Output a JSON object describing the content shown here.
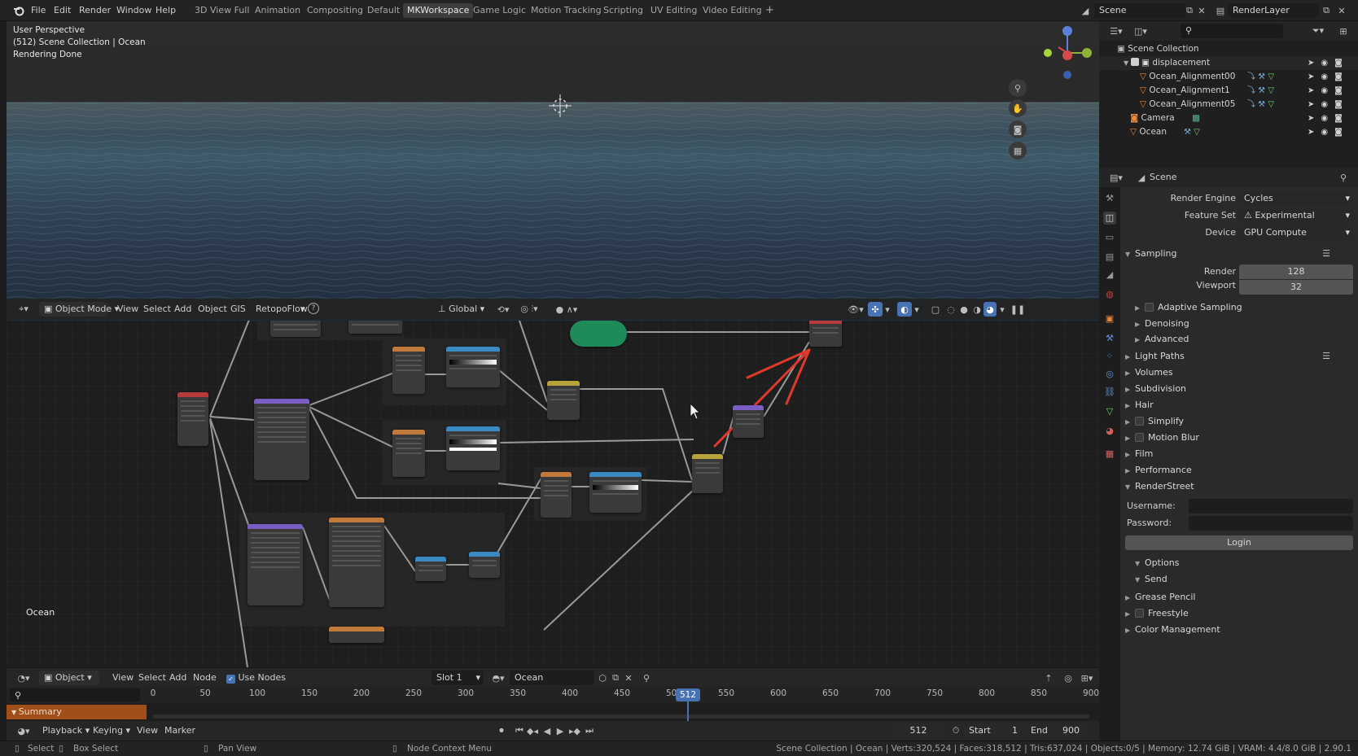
{
  "menu": [
    "File",
    "Edit",
    "Render",
    "Window",
    "Help"
  ],
  "workspaces": [
    "3D View Full",
    "Animation",
    "Compositing",
    "Default",
    "MKWorkspace",
    "Game Logic",
    "Motion Tracking",
    "Scripting",
    "UV Editing",
    "Video Editing"
  ],
  "active_workspace": "MKWorkspace",
  "scene_name": "Scene",
  "view_layer": "RenderLayer",
  "viewport": {
    "overlay_lines": [
      "User Perspective",
      "(512) Scene Collection | Ocean",
      "Rendering Done"
    ],
    "mode": "Object Mode",
    "menus": [
      "View",
      "Select",
      "Add",
      "Object",
      "GIS",
      "RetopoFlow"
    ],
    "orientation": "Global"
  },
  "node_editor": {
    "object_label": "Ocean",
    "type": "Object",
    "menus": [
      "View",
      "Select",
      "Add",
      "Node"
    ],
    "use_nodes_label": "Use Nodes",
    "slot": "Slot 1",
    "material": "Ocean"
  },
  "timeline": {
    "ticks": [
      "0",
      "50",
      "100",
      "150",
      "200",
      "250",
      "300",
      "350",
      "400",
      "450",
      "500",
      "550",
      "600",
      "650",
      "700",
      "750",
      "800",
      "850",
      "900"
    ],
    "current_frame": "512",
    "summary_label": "Summary",
    "menus": [
      "Playback",
      "Keying",
      "View",
      "Marker"
    ],
    "frame_field": "512",
    "start_label": "Start",
    "start": "1",
    "end_label": "End",
    "end": "900"
  },
  "outliner": {
    "root": "Scene Collection",
    "items": [
      {
        "name": "displacement",
        "depth": 1
      },
      {
        "name": "Ocean_Alignment00",
        "depth": 2
      },
      {
        "name": "Ocean_Alignment1",
        "depth": 2
      },
      {
        "name": "Ocean_Alignment05",
        "depth": 2
      },
      {
        "name": "Camera",
        "depth": 1
      },
      {
        "name": "Ocean",
        "depth": 1
      }
    ]
  },
  "properties": {
    "context": "Scene",
    "render_engine_label": "Render Engine",
    "render_engine": "Cycles",
    "feature_set_label": "Feature Set",
    "feature_set": "Experimental",
    "device_label": "Device",
    "device": "GPU Compute",
    "sampling": {
      "title": "Sampling",
      "render_label": "Render",
      "render": "128",
      "viewport_label": "Viewport",
      "viewport": "32",
      "subpanels": [
        "Adaptive Sampling",
        "Denoising",
        "Advanced"
      ]
    },
    "panels": [
      "Light Paths",
      "Volumes",
      "Subdivision",
      "Hair",
      "Simplify",
      "Motion Blur",
      "Film",
      "Performance"
    ],
    "renderstreet": {
      "title": "RenderStreet",
      "username_label": "Username:",
      "password_label": "Password:",
      "login_label": "Login",
      "options_label": "Options",
      "send_label": "Send"
    },
    "bottom_panels": [
      "Grease Pencil",
      "Freestyle",
      "Color Management"
    ]
  },
  "status": {
    "select": "Select",
    "box_select": "Box Select",
    "pan_view": "Pan View",
    "node_context": "Node Context Menu",
    "info": "Scene Collection | Ocean | Verts:320,524 | Faces:318,512 | Tris:637,024 | Objects:0/5 | Memory: 12.74 GiB | VRAM: 4.4/8.0 GiB | 2.90.1"
  },
  "colors": {
    "accent_blue": "#4772b3",
    "node_green": "#1f8a5a",
    "annotation_red": "#e0382a",
    "header_bg": "#232323"
  }
}
